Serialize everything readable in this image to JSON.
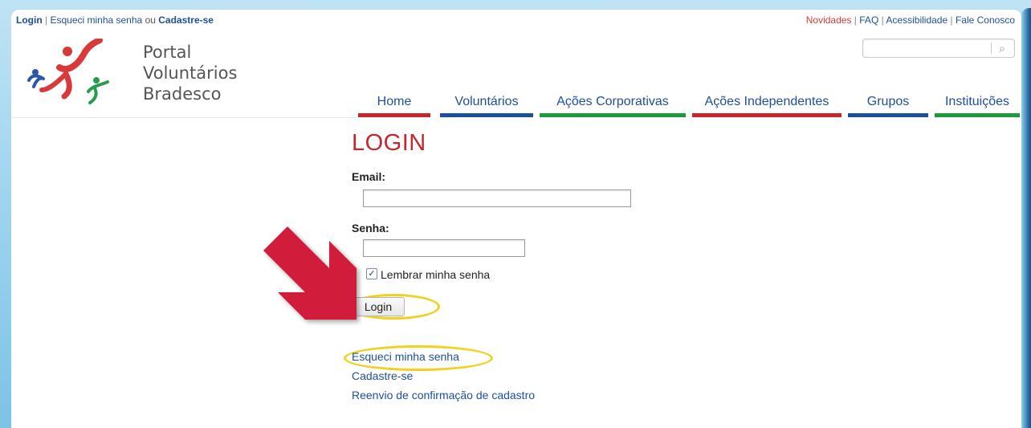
{
  "header": {
    "top_left": {
      "login": "Login",
      "sep": "|",
      "forgot": "Esqueci minha senha",
      "or": "ou",
      "signup": "Cadastre-se"
    },
    "top_right": {
      "news": "Novidades",
      "sep": "|",
      "faq": "FAQ",
      "accessibility": "Acessibilidade",
      "contact": "Fale Conosco"
    },
    "brand": {
      "line1": "Portal",
      "line2": "Voluntários",
      "line3": "Bradesco"
    },
    "search": {
      "value": "",
      "placeholder": ""
    }
  },
  "menu": {
    "items": [
      {
        "label": "Home",
        "color": "#c8262b"
      },
      {
        "label": "Voluntários",
        "color": "#1d4f9a"
      },
      {
        "label": "Ações Corporativas",
        "color": "#1e9a3b"
      },
      {
        "label": "Ações Independentes",
        "color": "#c8262b"
      },
      {
        "label": "Grupos",
        "color": "#1d4f9a"
      },
      {
        "label": "Instituições",
        "color": "#1e9a3b"
      }
    ]
  },
  "login": {
    "title": "LOGIN",
    "email_label": "Email:",
    "email_value": "",
    "password_label": "Senha:",
    "password_value": "",
    "remember_label": "Lembrar minha senha",
    "remember_checked": true,
    "submit_label": "Login"
  },
  "links": {
    "forgot": "Esqueci minha senha",
    "signup": "Cadastre-se",
    "resend": "Reenvio de confirmação de cadastro"
  }
}
